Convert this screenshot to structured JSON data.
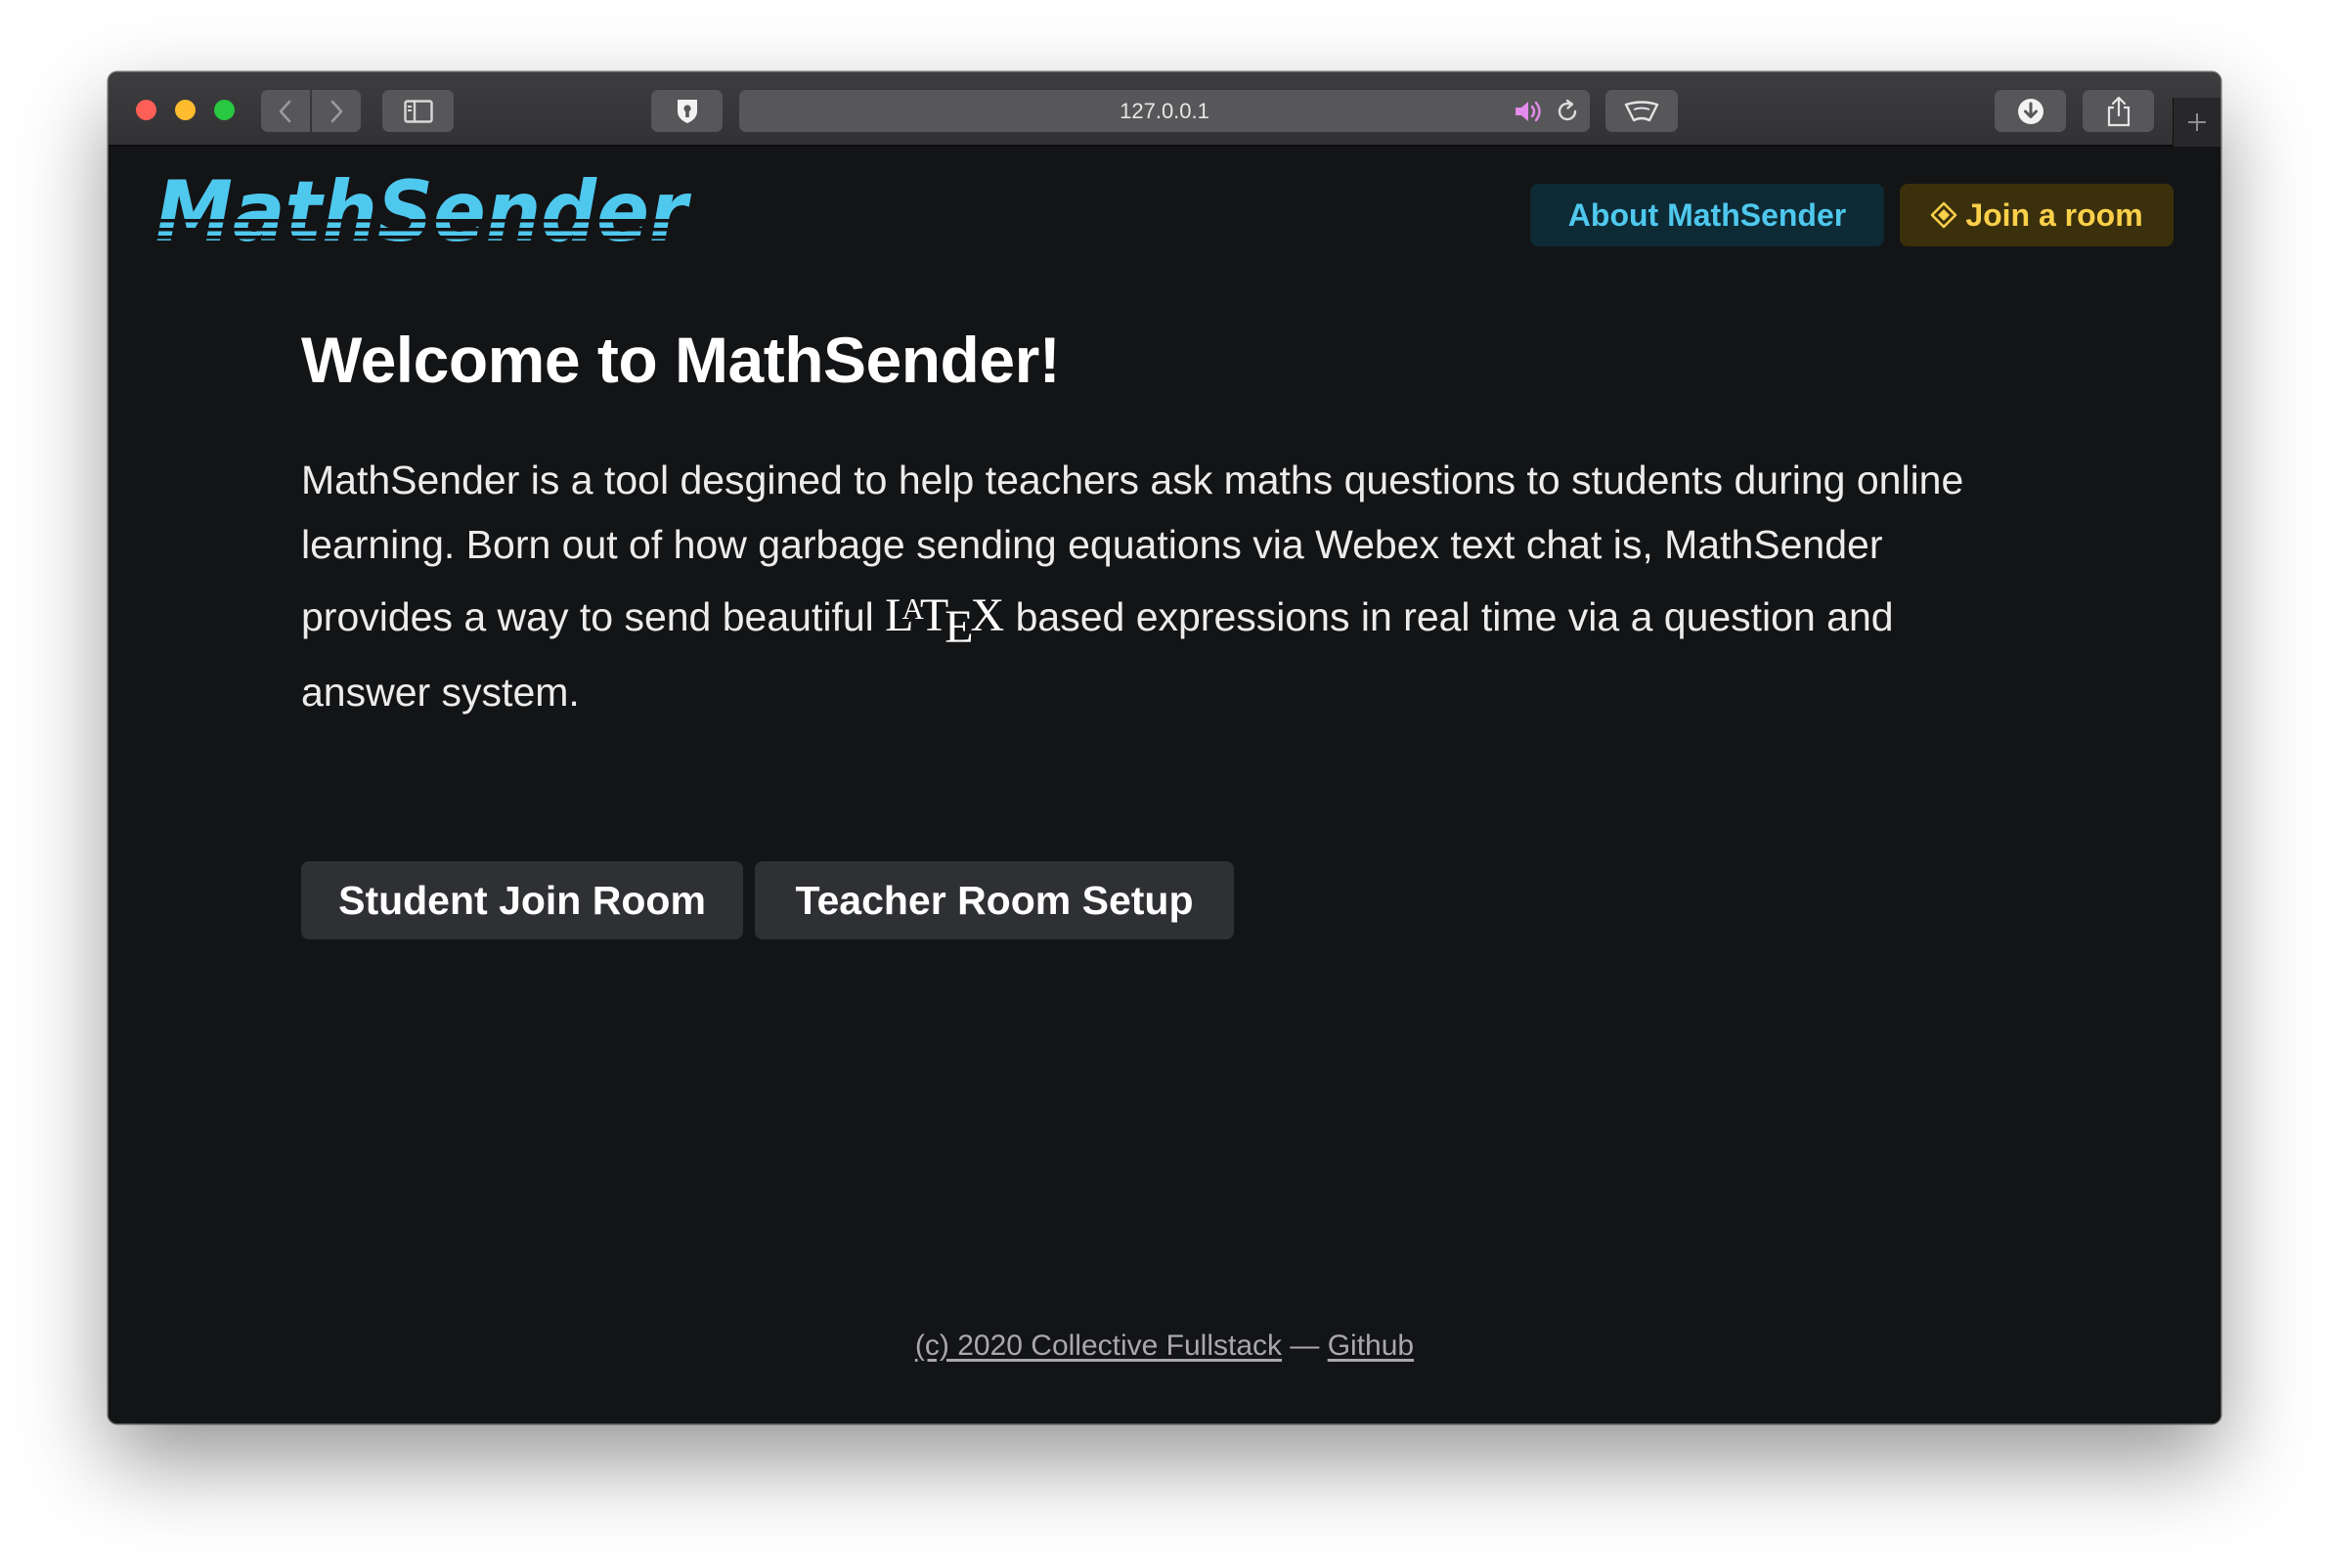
{
  "browser": {
    "url": "127.0.0.1"
  },
  "nav": {
    "logo_text": "MathSender",
    "about_label": "About MathSender",
    "join_label": "Join a room"
  },
  "hero": {
    "title": "Welcome to MathSender!",
    "paragraph_before": "MathSender is a tool desgined to help teachers ask maths questions to students during online learning. Born out of how garbage sending equations via Webex text chat is, MathSender provides a way to send beautiful ",
    "latex_parts": {
      "l": "L",
      "a": "A",
      "t": "T",
      "e": "E",
      "x": "X"
    },
    "paragraph_after": " based expressions in real time via a question and answer system."
  },
  "actions": {
    "student_label": "Student Join Room",
    "teacher_label": "Teacher Room Setup"
  },
  "footer": {
    "copyright_link": "(c) 2020 Collective Fullstack",
    "separator": " — ",
    "github_link": "Github"
  },
  "colors": {
    "logo": "#4fc8ee",
    "about_text": "#4fc8ee",
    "about_bg": "#0d2a35",
    "join_text": "#fbd04a",
    "join_bg": "#3b300c",
    "page_bg": "#131416",
    "button_bg": "#2f3033"
  },
  "icons": {
    "sidebar": "sidebar-icon",
    "shield": "shield-icon",
    "audio": "speaker-icon",
    "reload": "reload-icon",
    "reader": "reader-icon",
    "download": "download-icon",
    "share": "share-icon",
    "new_tab": "plus-icon",
    "join": "diamond-icon"
  }
}
